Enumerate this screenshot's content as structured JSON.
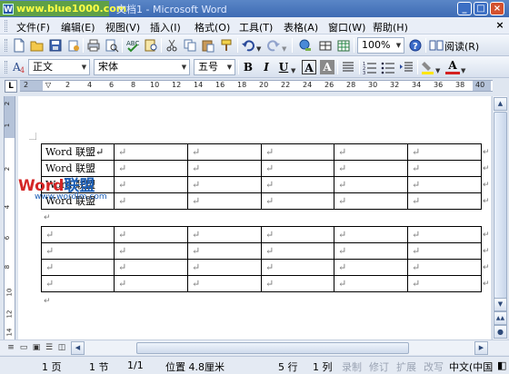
{
  "titlebar": {
    "watermark": "www.blue1000.com",
    "title": "文档1 - Microsoft Word",
    "app_icon": "W",
    "controls": {
      "minimize": "_",
      "maximize": "□",
      "close": "×"
    }
  },
  "menubar": {
    "items": [
      "文件(F)",
      "编辑(E)",
      "视图(V)",
      "插入(I)",
      "格式(O)",
      "工具(T)",
      "表格(A)",
      "窗口(W)",
      "帮助(H)"
    ],
    "close_doc": "×"
  },
  "standard_toolbar": {
    "icons": [
      "new-document-icon",
      "open-folder-icon",
      "save-icon",
      "permission-icon",
      "print-icon",
      "print-preview-icon",
      "spelling-icon",
      "research-icon",
      "cut-icon",
      "copy-icon",
      "paste-icon",
      "format-painter-icon",
      "undo-icon",
      "redo-icon",
      "hyperlink-icon",
      "tables-borders-icon",
      "insert-table-icon",
      "help-icon",
      "read-icon"
    ],
    "zoom": "100%",
    "read_label": "阅读(R)"
  },
  "formatting_toolbar": {
    "style": "正文",
    "font": "宋体",
    "size": "五号",
    "bold": "B",
    "italic": "I",
    "underline": "U",
    "char_border": "A",
    "char_shading": "A",
    "font_color_glyph": "A"
  },
  "ruler": {
    "tab_selector": "L",
    "marks": [
      "2",
      "2",
      "4",
      "6",
      "8",
      "10",
      "12",
      "14",
      "16",
      "18",
      "20",
      "22",
      "24",
      "26",
      "28",
      "30",
      "32",
      "34",
      "36",
      "38",
      "40"
    ],
    "vertical_marks": [
      "2",
      "1",
      "2",
      "4",
      "6",
      "8",
      "10",
      "12",
      "14"
    ]
  },
  "document": {
    "table1": [
      [
        "Word 联盟↵",
        "↵",
        "↵",
        "↵",
        "↵",
        "↵"
      ],
      [
        "Word 联盟",
        "↵",
        "↵",
        "↵",
        "↵",
        "↵"
      ],
      [
        "Word 联盟",
        "↵",
        "↵",
        "↵",
        "↵",
        "↵"
      ],
      [
        "Word 联盟",
        "↵",
        "↵",
        "↵",
        "↵",
        "↵"
      ]
    ],
    "table2": [
      [
        "↵",
        "↵",
        "↵",
        "↵",
        "↵",
        "↵"
      ],
      [
        "↵",
        "↵",
        "↵",
        "↵",
        "↵",
        "↵"
      ],
      [
        "↵",
        "↵",
        "↵",
        "↵",
        "↵",
        "↵"
      ],
      [
        "↵",
        "↵",
        "↵",
        "↵",
        "↵",
        "↵"
      ]
    ],
    "paragraph_marks": [
      "↵",
      "↵"
    ],
    "row_end_mark": "↵",
    "watermark_logo_a": "Word",
    "watermark_logo_b": "联盟",
    "watermark_url": "www.wordlm.com"
  },
  "status": {
    "page": "1 页",
    "section": "1 节",
    "page_of": "1/1",
    "position": "位置 4.8厘米",
    "line": "5 行",
    "column": "1 列",
    "record": "录制",
    "track": "修订",
    "extend": "扩展",
    "overtype": "改写",
    "language": "中文(中国"
  }
}
